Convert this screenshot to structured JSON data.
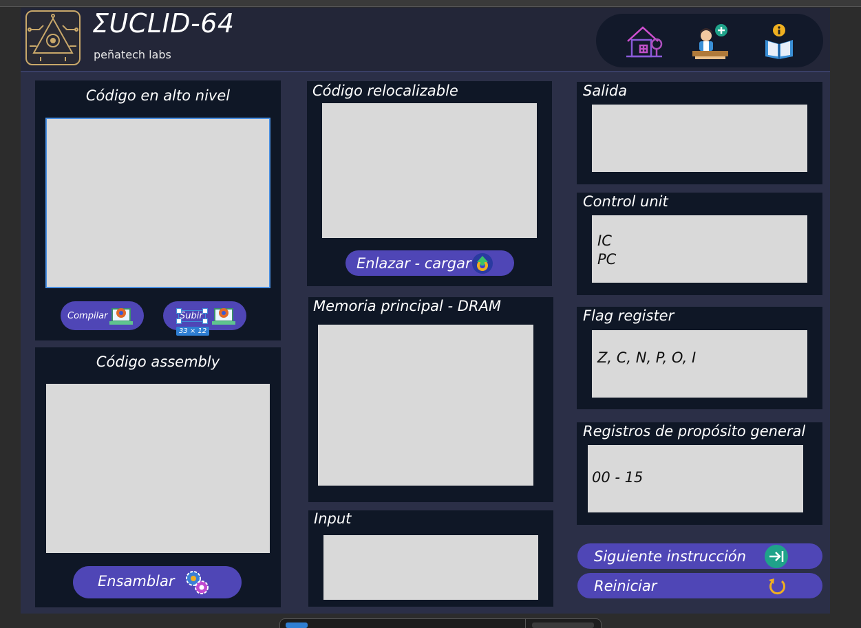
{
  "app": {
    "title": "ΣUCLID-64",
    "subtitle": "peñatech labs"
  },
  "nav": {
    "items": [
      {
        "name": "home-icon"
      },
      {
        "name": "user-add-icon"
      },
      {
        "name": "info-book-icon"
      }
    ]
  },
  "panels": {
    "high_level": {
      "title": "Código en alto nivel",
      "compile_label": "Compilar",
      "upload_label": "Subir",
      "selection_size": "33 × 12"
    },
    "assembly": {
      "title": "Código assembly",
      "assemble_label": "Ensamblar"
    },
    "relocatable": {
      "title": "Código relocalizable",
      "link_label": "Enlazar - cargar"
    },
    "dram": {
      "title": "Memoria principal - DRAM"
    },
    "input": {
      "title": "Input"
    },
    "output": {
      "title": "Salida"
    },
    "control_unit": {
      "title": "Control unit",
      "content": "IC\nPC"
    },
    "flag_register": {
      "title": "Flag register",
      "content": "Z, C, N, P, O, I"
    },
    "gp_registers": {
      "title": "Registros de propósito general",
      "content": "00 - 15"
    }
  },
  "actions": {
    "next_label": "Siguiente instrucción",
    "reset_label": "Reiniciar"
  },
  "colors": {
    "background": "#2b2f47",
    "panel": "#0f1726",
    "button": "#4f46b6",
    "textbox": "#d9d9d9",
    "accent_gold": "#c9a86a"
  }
}
